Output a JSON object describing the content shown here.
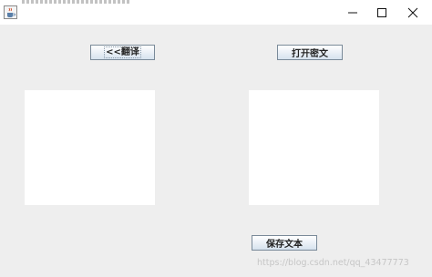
{
  "window": {
    "controls": {
      "minimize_icon": "minimize-icon",
      "maximize_icon": "maximize-icon",
      "close_icon": "close-icon"
    },
    "app_icon": "java-coffee-cup-icon"
  },
  "toolbar": {
    "translate_label": "<<翻译",
    "open_label": "打开密文",
    "save_label": "保存文本"
  },
  "panes": {
    "left_value": "",
    "right_value": ""
  },
  "watermark": {
    "text": "https://blog.csdn.net/qq_43477773"
  },
  "colors": {
    "background": "#eeeeee",
    "titlebar": "#ffffff",
    "button_border": "#7a8a99",
    "button_gradient_top": "#ffffff",
    "button_gradient_bottom": "#d6e2ee"
  }
}
